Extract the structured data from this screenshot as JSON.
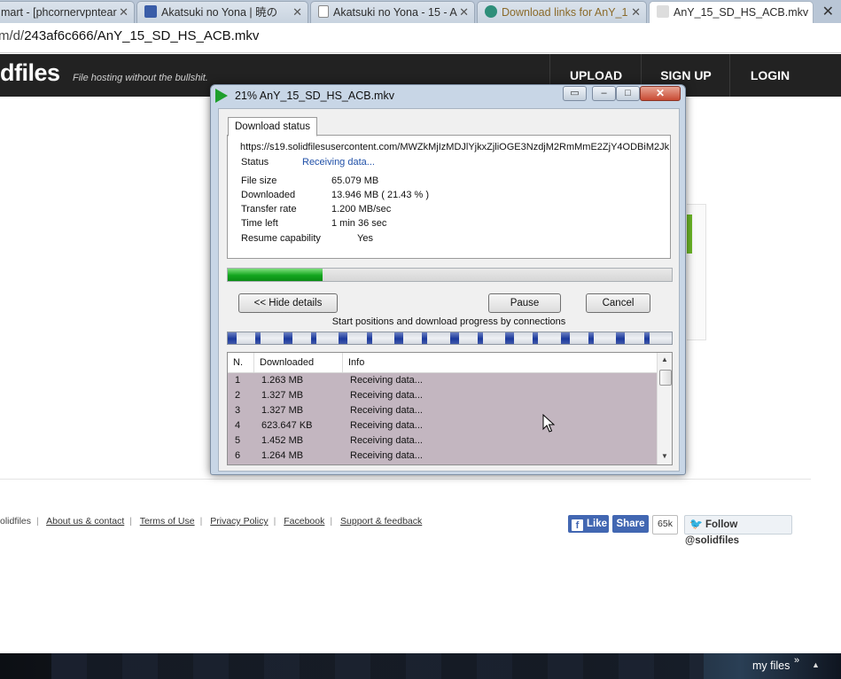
{
  "browser": {
    "tabs": [
      {
        "label": "mart - [phcornervpntear"
      },
      {
        "label": "Akatsuki no Yona | 暁の"
      },
      {
        "label": "Akatsuki no Yona - 15 - A"
      },
      {
        "label": "Download links for AnY_1"
      },
      {
        "label": "AnY_15_SD_HS_ACB.mkv"
      }
    ],
    "tab_close": "✕",
    "window_close": "✕",
    "url_prefix": "m/d/",
    "url_path": "243af6c666/AnY_15_SD_HS_ACB.mkv"
  },
  "site": {
    "logo": "dfiles",
    "tagline": "File hosting without the bullshit.",
    "nav": {
      "upload": "UPLOAD",
      "signup": "SIGN UP",
      "login": "LOGIN"
    },
    "footer_links": [
      "olidfiles",
      "About us & contact",
      "Terms of Use",
      "Privacy Policy",
      "Facebook",
      "Support & feedback"
    ],
    "social": {
      "like": "Like",
      "share": "Share",
      "count": "65k",
      "follow": "Follow @solidfiles"
    }
  },
  "dialog": {
    "title": "21% AnY_15_SD_HS_ACB.mkv",
    "status_tab": "Download status",
    "url": "https://s19.solidfilesusercontent.com/MWZkMjIzMDJlYjkxZjliOGE3NzdjM2RmMmE2ZjY4ODBiM2Jk",
    "status_label": "Status",
    "status_value": "Receiving data...",
    "file_size_label": "File size",
    "file_size": "65.079  MB",
    "downloaded_label": "Downloaded",
    "downloaded": "13.946  MB  ( 21.43 % )",
    "transfer_rate_label": "Transfer rate",
    "transfer_rate": "1.200  MB/sec",
    "time_left_label": "Time left",
    "time_left": "1 min 36 sec",
    "resume_label": "Resume capability",
    "resume": "Yes",
    "progress_fraction": 0.2143,
    "progress_color": "#12a51e",
    "buttons": {
      "hide_details": "<< Hide details",
      "pause": "Pause",
      "cancel": "Cancel"
    },
    "connections_caption": "Start positions and download progress by connections",
    "columns": {
      "n": "N.",
      "downloaded": "Downloaded",
      "info": "Info"
    },
    "connections": [
      {
        "n": "1",
        "downloaded": "1.263  MB",
        "info": "Receiving data..."
      },
      {
        "n": "2",
        "downloaded": "1.327  MB",
        "info": "Receiving data..."
      },
      {
        "n": "3",
        "downloaded": "1.327  MB",
        "info": "Receiving data..."
      },
      {
        "n": "4",
        "downloaded": "623.647  KB",
        "info": "Receiving data..."
      },
      {
        "n": "5",
        "downloaded": "1.452  MB",
        "info": "Receiving data..."
      },
      {
        "n": "6",
        "downloaded": "1.264  MB",
        "info": "Receiving data..."
      }
    ]
  },
  "taskbar": {
    "label": "my files",
    "chevron": "»",
    "tray": "▲"
  }
}
